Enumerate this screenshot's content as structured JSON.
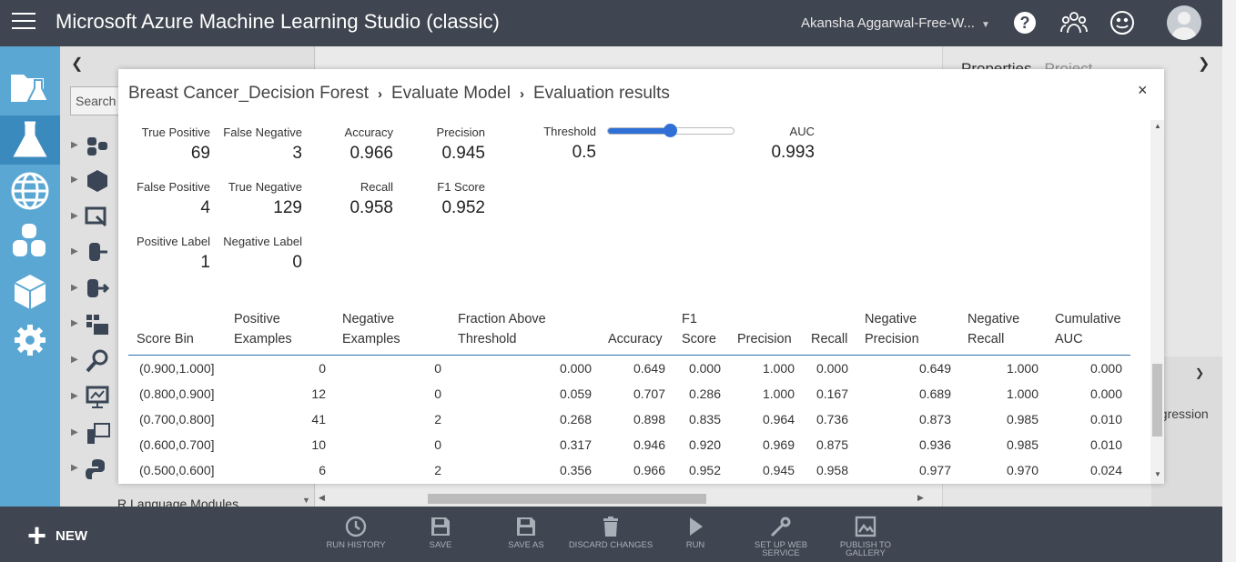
{
  "app": {
    "title": "Microsoft Azure Machine Learning Studio (classic)",
    "user": "Akansha Aggarwal-Free-W..."
  },
  "icons": {
    "top": [
      "menu-icon",
      "help-icon",
      "community-icon",
      "feedback-smiley-icon",
      "user-avatar-icon"
    ],
    "nav": [
      "projects-icon",
      "experiments-icon",
      "web-services-icon",
      "datasets-icon",
      "trained-models-icon",
      "settings-icon"
    ]
  },
  "palette": {
    "search_label": "Search",
    "bottom_item": "R Language Modules"
  },
  "properties": {
    "tab_properties": "Properties",
    "tab_project": "Project",
    "partial_text": "egression"
  },
  "bottom_bar": {
    "new_label": "NEW",
    "commands": [
      {
        "icon": "history-icon",
        "label": "RUN HISTORY"
      },
      {
        "icon": "save-icon",
        "label": "SAVE"
      },
      {
        "icon": "save-as-icon",
        "label": "SAVE AS"
      },
      {
        "icon": "trash-icon",
        "label": "DISCARD CHANGES"
      },
      {
        "icon": "play-icon",
        "label": "RUN"
      },
      {
        "icon": "web-service-icon",
        "label": "SET UP WEB SERVICE"
      },
      {
        "icon": "gallery-icon",
        "label": "PUBLISH TO GALLERY"
      }
    ]
  },
  "dialog": {
    "breadcrumb": [
      "Breast Cancer_Decision Forest",
      "Evaluate Model",
      "Evaluation results"
    ],
    "close": "×",
    "metrics": {
      "true_positive": {
        "label": "True Positive",
        "value": "69"
      },
      "false_negative": {
        "label": "False Negative",
        "value": "3"
      },
      "accuracy": {
        "label": "Accuracy",
        "value": "0.966"
      },
      "precision": {
        "label": "Precision",
        "value": "0.945"
      },
      "threshold": {
        "label": "Threshold",
        "value": "0.5",
        "level": 0.5
      },
      "auc": {
        "label": "AUC",
        "value": "0.993"
      },
      "false_positive": {
        "label": "False Positive",
        "value": "4"
      },
      "true_negative": {
        "label": "True Negative",
        "value": "129"
      },
      "recall": {
        "label": "Recall",
        "value": "0.958"
      },
      "f1": {
        "label": "F1 Score",
        "value": "0.952"
      },
      "positive_label": {
        "label": "Positive Label",
        "value": "1"
      },
      "negative_label": {
        "label": "Negative Label",
        "value": "0"
      }
    },
    "table": {
      "headers": [
        [
          "Score Bin"
        ],
        [
          "Positive",
          "Examples"
        ],
        [
          "Negative",
          "Examples"
        ],
        [
          "Fraction Above",
          "Threshold"
        ],
        [
          "Accuracy"
        ],
        [
          "F1",
          "Score"
        ],
        [
          "Precision"
        ],
        [
          "Recall"
        ],
        [
          "Negative",
          "Precision"
        ],
        [
          "Negative",
          "Recall"
        ],
        [
          "Cumulative",
          "AUC"
        ]
      ],
      "rows": [
        [
          "(0.900,1.000]",
          "0",
          "0",
          "0.000",
          "0.649",
          "0.000",
          "1.000",
          "0.000",
          "0.649",
          "1.000",
          "0.000"
        ],
        [
          "(0.800,0.900]",
          "12",
          "0",
          "0.059",
          "0.707",
          "0.286",
          "1.000",
          "0.167",
          "0.689",
          "1.000",
          "0.000"
        ],
        [
          "(0.700,0.800]",
          "41",
          "2",
          "0.268",
          "0.898",
          "0.835",
          "0.964",
          "0.736",
          "0.873",
          "0.985",
          "0.010"
        ],
        [
          "(0.600,0.700]",
          "10",
          "0",
          "0.317",
          "0.946",
          "0.920",
          "0.969",
          "0.875",
          "0.936",
          "0.985",
          "0.010"
        ],
        [
          "(0.500,0.600]",
          "6",
          "2",
          "0.356",
          "0.966",
          "0.952",
          "0.945",
          "0.958",
          "0.977",
          "0.970",
          "0.024"
        ]
      ]
    }
  }
}
